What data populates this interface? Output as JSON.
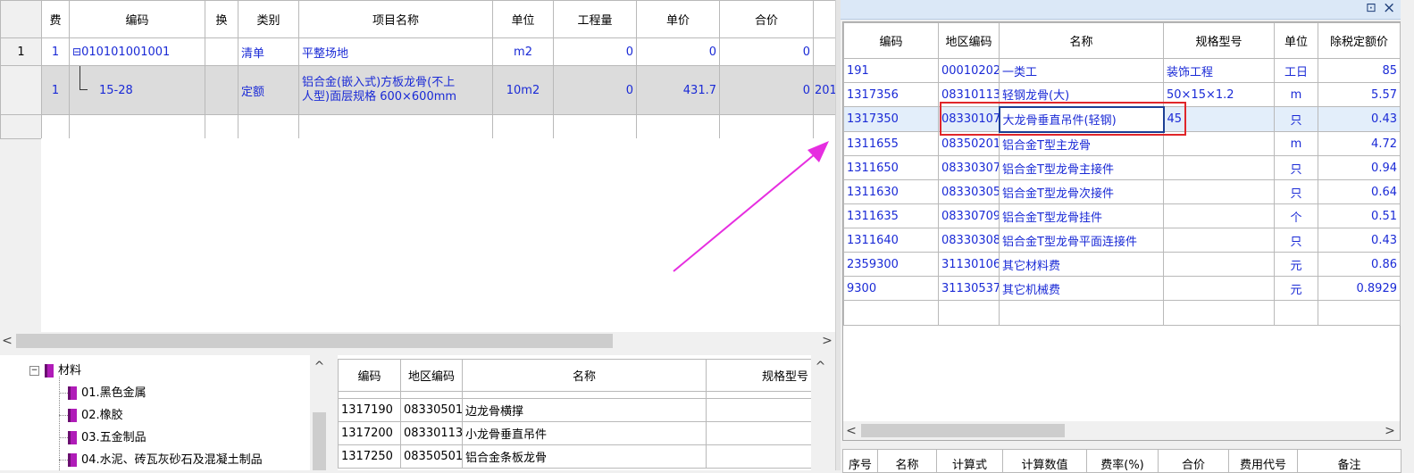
{
  "left_grid": {
    "headers": [
      "费",
      "编码",
      "换",
      "类别",
      "项目名称",
      "单位",
      "工程量",
      "单价",
      "合价"
    ],
    "rows": [
      {
        "rownum": "1",
        "fee": "1",
        "toggle": "⊟",
        "code": "010101001001",
        "huan": "",
        "type": "清单",
        "name_line1": "平整场地",
        "name_line2": "",
        "unit": "m2",
        "qty": "0",
        "price": "0",
        "total": "0",
        "extra": ""
      },
      {
        "rownum": "",
        "fee": "1",
        "toggle": "",
        "code": "15-28",
        "huan": "",
        "type": "定额",
        "name_line1": "铝合金(嵌入式)方板龙骨(不上",
        "name_line2": "人型)面层规格 600×600mm",
        "unit": "10m2",
        "qty": "0",
        "price": "431.7",
        "total": "0",
        "extra": "201"
      }
    ]
  },
  "tree": {
    "root": "材料",
    "items": [
      "01.黑色金属",
      "02.橡胶",
      "03.五金制品",
      "04.水泥、砖瓦灰砂石及混凝土制品"
    ]
  },
  "bottom_grid": {
    "headers": [
      "编码",
      "地区编码",
      "名称",
      "规格型号"
    ],
    "rows": [
      {
        "code": "1317190",
        "area": "08330501",
        "name": "边龙骨横撑",
        "spec": ""
      },
      {
        "code": "1317200",
        "area": "08330113",
        "name": "小龙骨垂直吊件",
        "spec": ""
      },
      {
        "code": "1317250",
        "area": "08350501",
        "name": "铝合金条板龙骨",
        "spec": ""
      }
    ]
  },
  "right_panel": {
    "title_buttons": {
      "restore": "⊡",
      "close": "×"
    },
    "headers": [
      "编码",
      "地区编码",
      "名称",
      "规格型号",
      "单位",
      "除税定额价"
    ],
    "rows": [
      {
        "code": "191",
        "area": "00010202",
        "name": "一类工",
        "spec": "装饰工程",
        "unit": "工日",
        "price": "85"
      },
      {
        "code": "1317356",
        "area": "08310113",
        "name": "轻钢龙骨(大)",
        "spec": "50×15×1.2",
        "unit": "m",
        "price": "5.57"
      },
      {
        "code": "1317350",
        "area": "08330107",
        "name": "大龙骨垂直吊件(轻钢)",
        "spec": "45",
        "unit": "只",
        "price": "0.43"
      },
      {
        "code": "1311655",
        "area": "08350201",
        "name": "铝合金T型主龙骨",
        "spec": "",
        "unit": "m",
        "price": "4.72"
      },
      {
        "code": "1311650",
        "area": "08330307",
        "name": "铝合金T型龙骨主接件",
        "spec": "",
        "unit": "只",
        "price": "0.94"
      },
      {
        "code": "1311630",
        "area": "08330305",
        "name": "铝合金T型龙骨次接件",
        "spec": "",
        "unit": "只",
        "price": "0.64"
      },
      {
        "code": "1311635",
        "area": "08330709",
        "name": "铝合金T型龙骨挂件",
        "spec": "",
        "unit": "个",
        "price": "0.51"
      },
      {
        "code": "1311640",
        "area": "08330308",
        "name": "铝合金T型龙骨平面连接件",
        "spec": "",
        "unit": "只",
        "price": "0.43"
      },
      {
        "code": "2359300",
        "area": "31130106",
        "name": "其它材料费",
        "spec": "",
        "unit": "元",
        "price": "0.86"
      },
      {
        "code": "9300",
        "area": "31130537",
        "name": "其它机械费",
        "spec": "",
        "unit": "元",
        "price": "0.8929"
      }
    ],
    "footer_headers": [
      "序号",
      "名称",
      "计算式",
      "计算数值",
      "费率(%)",
      "合价",
      "费用代号",
      "备注"
    ]
  },
  "colors": {
    "annotation_red": "#e0262a",
    "arrow_magenta": "#e62ee0",
    "link_blue": "#1a2ad6",
    "book_purple": "#b01cb8"
  },
  "scroll_arrows": {
    "left": "<",
    "right": ">",
    "up": "^"
  }
}
